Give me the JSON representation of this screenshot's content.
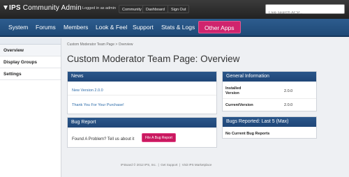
{
  "topbar": {
    "app_title_ips": "IPS",
    "app_title_rest": " Community Admin",
    "logged_in_text": "Logged in as admin",
    "buttons": [
      "Community",
      "Dashboard",
      "Sign Out"
    ],
    "search_placeholder": "Live search ACP..."
  },
  "nav": {
    "items": [
      "System",
      "Forums",
      "Members",
      "Look & Feel",
      "Support",
      "Stats & Logs",
      "Other Apps"
    ],
    "active_index": 6,
    "active_color": "#d0246d"
  },
  "sidebar": {
    "items": [
      "Overview",
      "Display Groups",
      "Settings"
    ],
    "active_index": 0
  },
  "breadcrumb": "Custom Moderator Team Page  >  Overview",
  "page_title": "Custom Moderator Team Page: Overview",
  "news": {
    "title": "News",
    "items": [
      "New Version 2.0.0",
      "Thank You For Your Purchase!"
    ]
  },
  "bug_report": {
    "title": "Bug Report",
    "text": "Found A Problem? Tell us about it",
    "button": "File A Bug Report"
  },
  "general_info": {
    "title": "General Information",
    "rows": [
      {
        "label": "Installed Version",
        "value": "2.0.0"
      },
      {
        "label": "CurrentVersion",
        "value": "2.0.0"
      }
    ]
  },
  "bugs_reported": {
    "title": "Bugs Reported: Last 5 (Max)",
    "empty_text": "No Current Bug Reports"
  },
  "footer": {
    "copyright": "IP.Board © 2012 IPS, Inc.",
    "separator": "|",
    "links": [
      "Get Support",
      "Visit IPS Marketplace"
    ]
  }
}
